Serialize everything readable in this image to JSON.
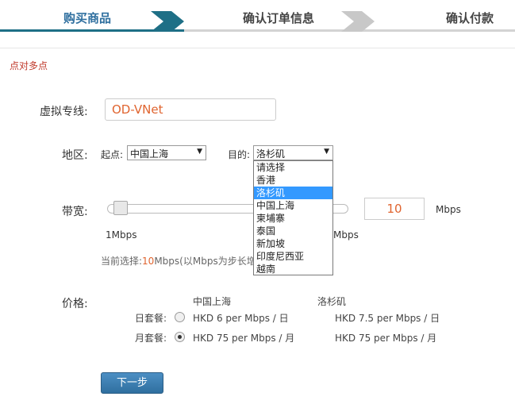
{
  "steps": {
    "step1": "购买商品",
    "step2": "确认订单信息",
    "step3": "确认付款"
  },
  "section_title": "点对多点",
  "vnet": {
    "label": "虚拟专线:",
    "value": "OD-VNet"
  },
  "region": {
    "label": "地区:",
    "origin_label": "起点:",
    "origin_value": "中国上海",
    "dest_label": "目的:",
    "dest_value": "洛杉矶",
    "options": [
      "请选择",
      "香港",
      "洛杉矶",
      "中国上海",
      "柬埔寨",
      "泰国",
      "新加坡",
      "印度尼西亚",
      "越南"
    ],
    "selected_option": "洛杉矶"
  },
  "bandwidth": {
    "label": "带宽:",
    "value": "10",
    "unit": "Mbps",
    "min_label": "1Mbps",
    "max_label_partial": "Mbps",
    "current_prefix": "当前选择:",
    "current_value": "10",
    "current_suffix": "Mbps(以Mbps为步长增",
    "slider_fraction": 0.02
  },
  "price": {
    "label": "价格:",
    "col1_header": "中国上海",
    "col2_header": "洛杉矶",
    "daily_label": "日套餐:",
    "daily_col1": "HKD 6 per Mbps / 日",
    "daily_col2": "HKD 7.5 per Mbps / 日",
    "monthly_label": "月套餐:",
    "monthly_col1": "HKD 75 per Mbps / 月",
    "monthly_col2": "HKD 75 per Mbps / 月",
    "selected_plan": "月套餐"
  },
  "next_button": "下一步",
  "colors": {
    "accent": "#1e6f86",
    "highlight": "#e0642f",
    "section_title": "#c0392b",
    "dropdown_selected": "#3399ff"
  }
}
